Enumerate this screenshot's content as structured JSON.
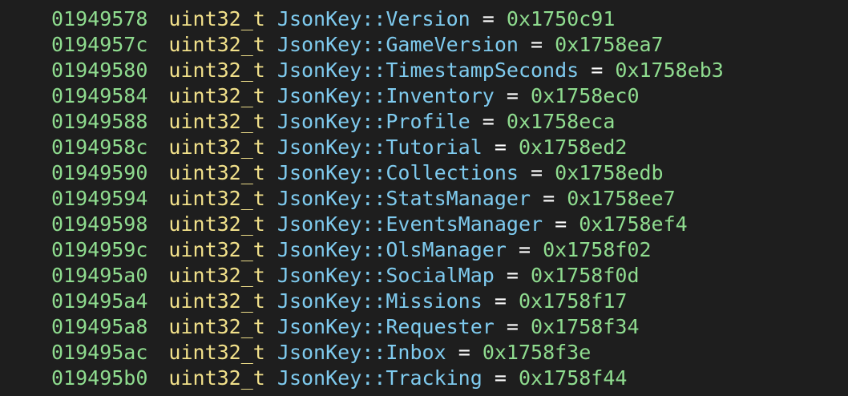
{
  "code": {
    "separator": "::",
    "operator": "=",
    "lines": [
      {
        "address": "01949578",
        "type": "uint32_t",
        "namespace": "JsonKey",
        "member": "Version",
        "value": "0x1750c91"
      },
      {
        "address": "0194957c",
        "type": "uint32_t",
        "namespace": "JsonKey",
        "member": "GameVersion",
        "value": "0x1758ea7"
      },
      {
        "address": "01949580",
        "type": "uint32_t",
        "namespace": "JsonKey",
        "member": "TimestampSeconds",
        "value": "0x1758eb3"
      },
      {
        "address": "01949584",
        "type": "uint32_t",
        "namespace": "JsonKey",
        "member": "Inventory",
        "value": "0x1758ec0"
      },
      {
        "address": "01949588",
        "type": "uint32_t",
        "namespace": "JsonKey",
        "member": "Profile",
        "value": "0x1758eca"
      },
      {
        "address": "0194958c",
        "type": "uint32_t",
        "namespace": "JsonKey",
        "member": "Tutorial",
        "value": "0x1758ed2"
      },
      {
        "address": "01949590",
        "type": "uint32_t",
        "namespace": "JsonKey",
        "member": "Collections",
        "value": "0x1758edb"
      },
      {
        "address": "01949594",
        "type": "uint32_t",
        "namespace": "JsonKey",
        "member": "StatsManager",
        "value": "0x1758ee7"
      },
      {
        "address": "01949598",
        "type": "uint32_t",
        "namespace": "JsonKey",
        "member": "EventsManager",
        "value": "0x1758ef4"
      },
      {
        "address": "0194959c",
        "type": "uint32_t",
        "namespace": "JsonKey",
        "member": "OlsManager",
        "value": "0x1758f02"
      },
      {
        "address": "019495a0",
        "type": "uint32_t",
        "namespace": "JsonKey",
        "member": "SocialMap",
        "value": "0x1758f0d"
      },
      {
        "address": "019495a4",
        "type": "uint32_t",
        "namespace": "JsonKey",
        "member": "Missions",
        "value": "0x1758f17"
      },
      {
        "address": "019495a8",
        "type": "uint32_t",
        "namespace": "JsonKey",
        "member": "Requester",
        "value": "0x1758f34"
      },
      {
        "address": "019495ac",
        "type": "uint32_t",
        "namespace": "JsonKey",
        "member": "Inbox",
        "value": "0x1758f3e"
      },
      {
        "address": "019495b0",
        "type": "uint32_t",
        "namespace": "JsonKey",
        "member": "Tracking",
        "value": "0x1758f44"
      }
    ]
  },
  "colors": {
    "background": "#1e1e1e",
    "address": "#8fdc8f",
    "type": "#f1e08a",
    "identifier": "#7fcbef",
    "operator": "#ffffff",
    "value": "#8fdc8f"
  }
}
